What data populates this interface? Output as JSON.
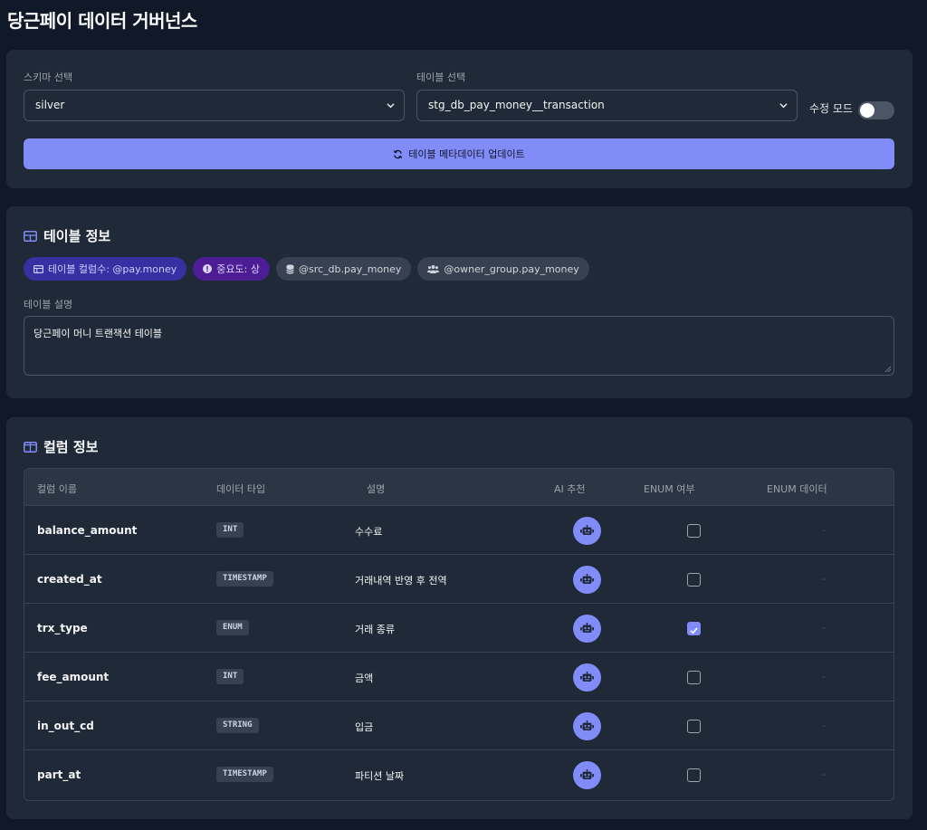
{
  "page": {
    "title": "당근페이 데이터 거버넌스"
  },
  "selectors": {
    "schema_label": "스키마 선택",
    "schema_value": "silver",
    "table_label": "테이블 선택",
    "table_value": "stg_db_pay_money__transaction",
    "edit_mode_label": "수정 모드",
    "edit_mode_on": false,
    "update_button": "테이블 메타데이터 업데이트"
  },
  "table_info": {
    "title": "테이블 정보",
    "badges": [
      {
        "text": "테이블 컬럼수: @pay.money",
        "icon": "table-icon"
      },
      {
        "text": "중요도: 상",
        "icon": "info-icon"
      },
      {
        "text": "@src_db.pay_money",
        "icon": "database-icon"
      },
      {
        "text": "@owner_group.pay_money",
        "icon": "users-icon"
      }
    ],
    "description_label": "테이블 설명",
    "description": "당근페이 머니 트랜잭션 테이블"
  },
  "columns": {
    "title": "컬럼 정보",
    "headers": [
      "컬럼 이름",
      "데이터 타입",
      "설명",
      "AI 추천",
      "ENUM 여부",
      "ENUM 데이터"
    ],
    "rows": [
      {
        "name": "balance_amount",
        "type": "INT",
        "desc": "수수료",
        "enum": false,
        "enum_data": "-"
      },
      {
        "name": "created_at",
        "type": "TIMESTAMP",
        "desc": "거래내역 반영 후 전역",
        "enum": false,
        "enum_data": "-"
      },
      {
        "name": "trx_type",
        "type": "ENUM",
        "desc": "거래 종류",
        "enum": true,
        "enum_data": "-"
      },
      {
        "name": "fee_amount",
        "type": "INT",
        "desc": "금액",
        "enum": false,
        "enum_data": "-"
      },
      {
        "name": "in_out_cd",
        "type": "STRING",
        "desc": "입금",
        "enum": false,
        "enum_data": "-"
      },
      {
        "name": "part_at",
        "type": "TIMESTAMP",
        "desc": "파티션 날짜",
        "enum": false,
        "enum_data": "-"
      }
    ]
  },
  "colors": {
    "background": "#111827",
    "card": "#1f2937",
    "accent": "#818cf8"
  }
}
